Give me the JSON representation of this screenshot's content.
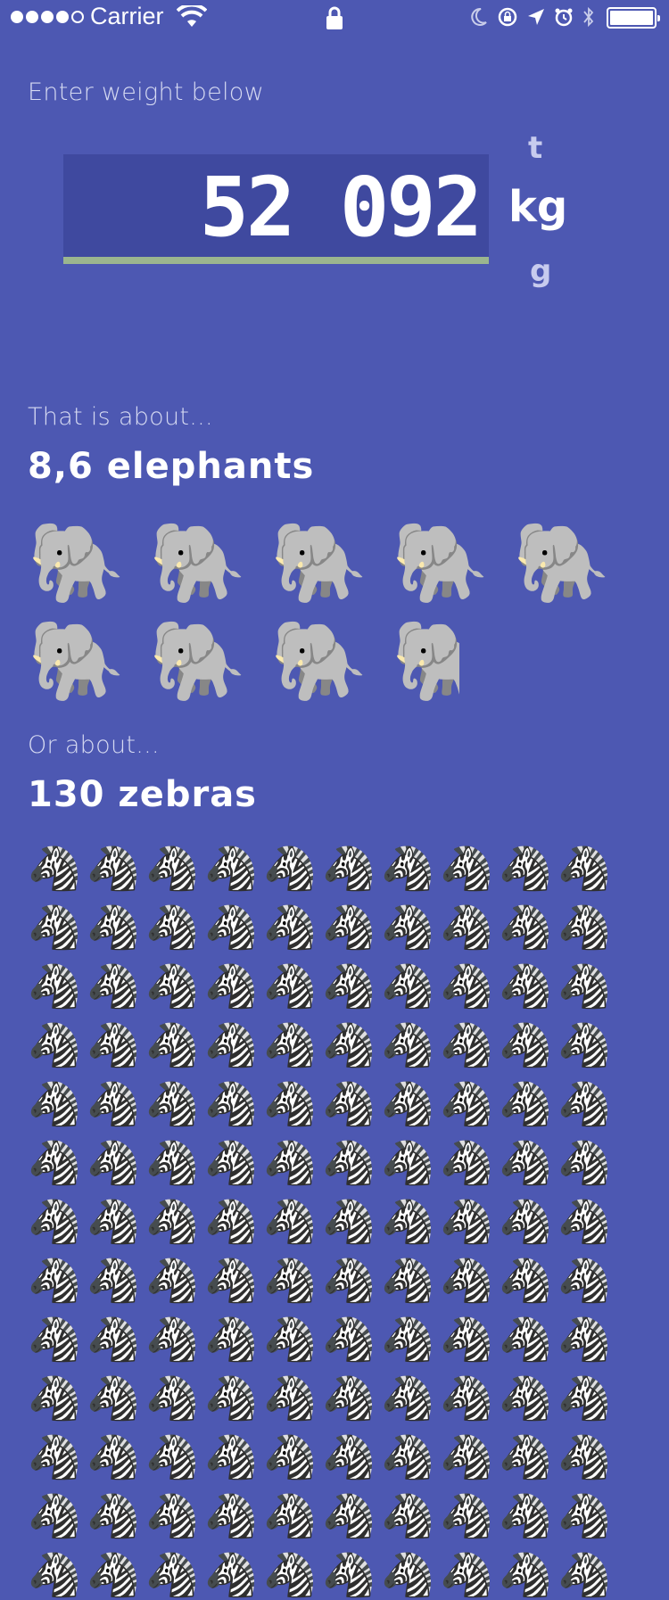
{
  "status_bar": {
    "carrier": "Carrier",
    "signal_bars": 4,
    "signal_total": 5
  },
  "input": {
    "label": "Enter weight below",
    "value": "52 092"
  },
  "units": {
    "ton": "t",
    "kilogram": "kg",
    "gram": "g",
    "selected": "kg"
  },
  "elephants": {
    "intro": "That is about...",
    "result": "8,6 elephants",
    "count": 8.6,
    "emoji": "🐘"
  },
  "zebras": {
    "intro": "Or about...",
    "result": "130 zebras",
    "count": 130,
    "emoji": "🦓"
  },
  "colors": {
    "background": "#4d58b2",
    "input_background": "#3f499f",
    "underline": "#9bb58f",
    "muted_text": "#d6daf2"
  }
}
